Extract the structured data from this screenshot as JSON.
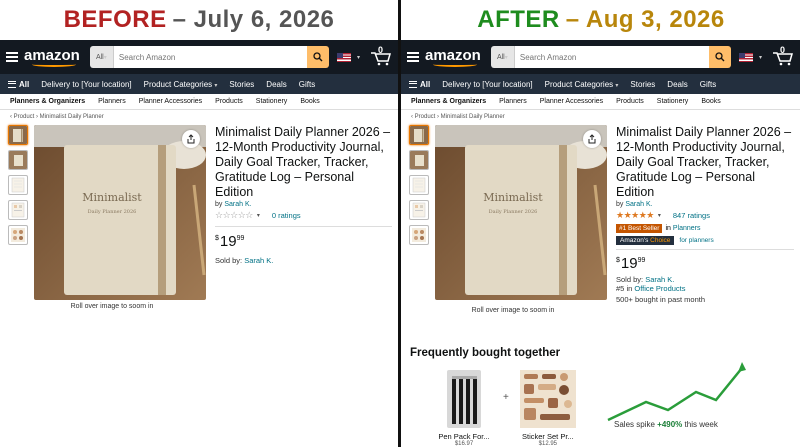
{
  "colors": {
    "before": "#b22222",
    "after": "#1e8c1e",
    "after_date": "#b8860b",
    "amazon_dark": "#131921",
    "amazon_nav": "#232f3e",
    "orange": "#febd69",
    "star": "#de7921",
    "link": "#007185",
    "bestseller": "#c45500"
  },
  "before": {
    "header_word": "BEFORE",
    "header_date": "– July 6, 2026"
  },
  "after": {
    "header_word": "AFTER",
    "header_date": "– Aug 3, 2026"
  },
  "nav": {
    "logo": "amazon",
    "search_scope": "All",
    "search_placeholder": "Search Amazon",
    "cart_count": "0",
    "all_label": "All",
    "delivery": "Delivery to [Your location]",
    "categories": "Product Categories",
    "stories": "Stories",
    "deals": "Deals",
    "gifts": "Gifts",
    "sub": [
      "Planners & Organizers",
      "Planners",
      "Planner Accessories",
      "Products",
      "Stationery",
      "Books"
    ]
  },
  "product": {
    "breadcrumb": "‹ Product › Minimalist Daily Planner",
    "title": "Minimalist Daily Planner 2026 – 12-Month Productivity Journal, Daily Goal Tracker, Tracker, Gratitude Log – Personal Edition",
    "by_prefix": "by",
    "brand": "Sarah K.",
    "price_symbol": "$",
    "price_whole": "19",
    "price_frac": "99",
    "sold_by_prefix": "Sold by:",
    "sold_by": "Sarah K.",
    "rollover": "Roll over image to soom in",
    "cover_text": "Minimalist",
    "cover_sub": "Daily Planner 2026"
  },
  "before_rating": {
    "stars": "☆☆☆☆☆",
    "count": "0 ratings",
    "value": 0
  },
  "after_rating": {
    "stars": "★★★★★",
    "count": "847 ratings",
    "value": 5
  },
  "after_extra": {
    "best_seller": "#1 Best Seller",
    "best_seller_in": "in",
    "best_seller_cat": "Planners",
    "choice_prefix": "Amazon's",
    "choice_word": "Choice",
    "choice_for": "for planners",
    "rank_num": "#5",
    "rank_in": "in",
    "rank_cat": "Office Products",
    "bought": "500+ bought in past month"
  },
  "fbt": {
    "title": "Frequently bought together",
    "items": [
      {
        "name": "Pen Pack For...",
        "price": "$16.97"
      },
      {
        "name": "Sticker Set Pr...",
        "price": "$12.95"
      }
    ],
    "plus": "+"
  },
  "spike": {
    "label": "Sales spike",
    "value": "+490%",
    "suffix": "this week"
  }
}
